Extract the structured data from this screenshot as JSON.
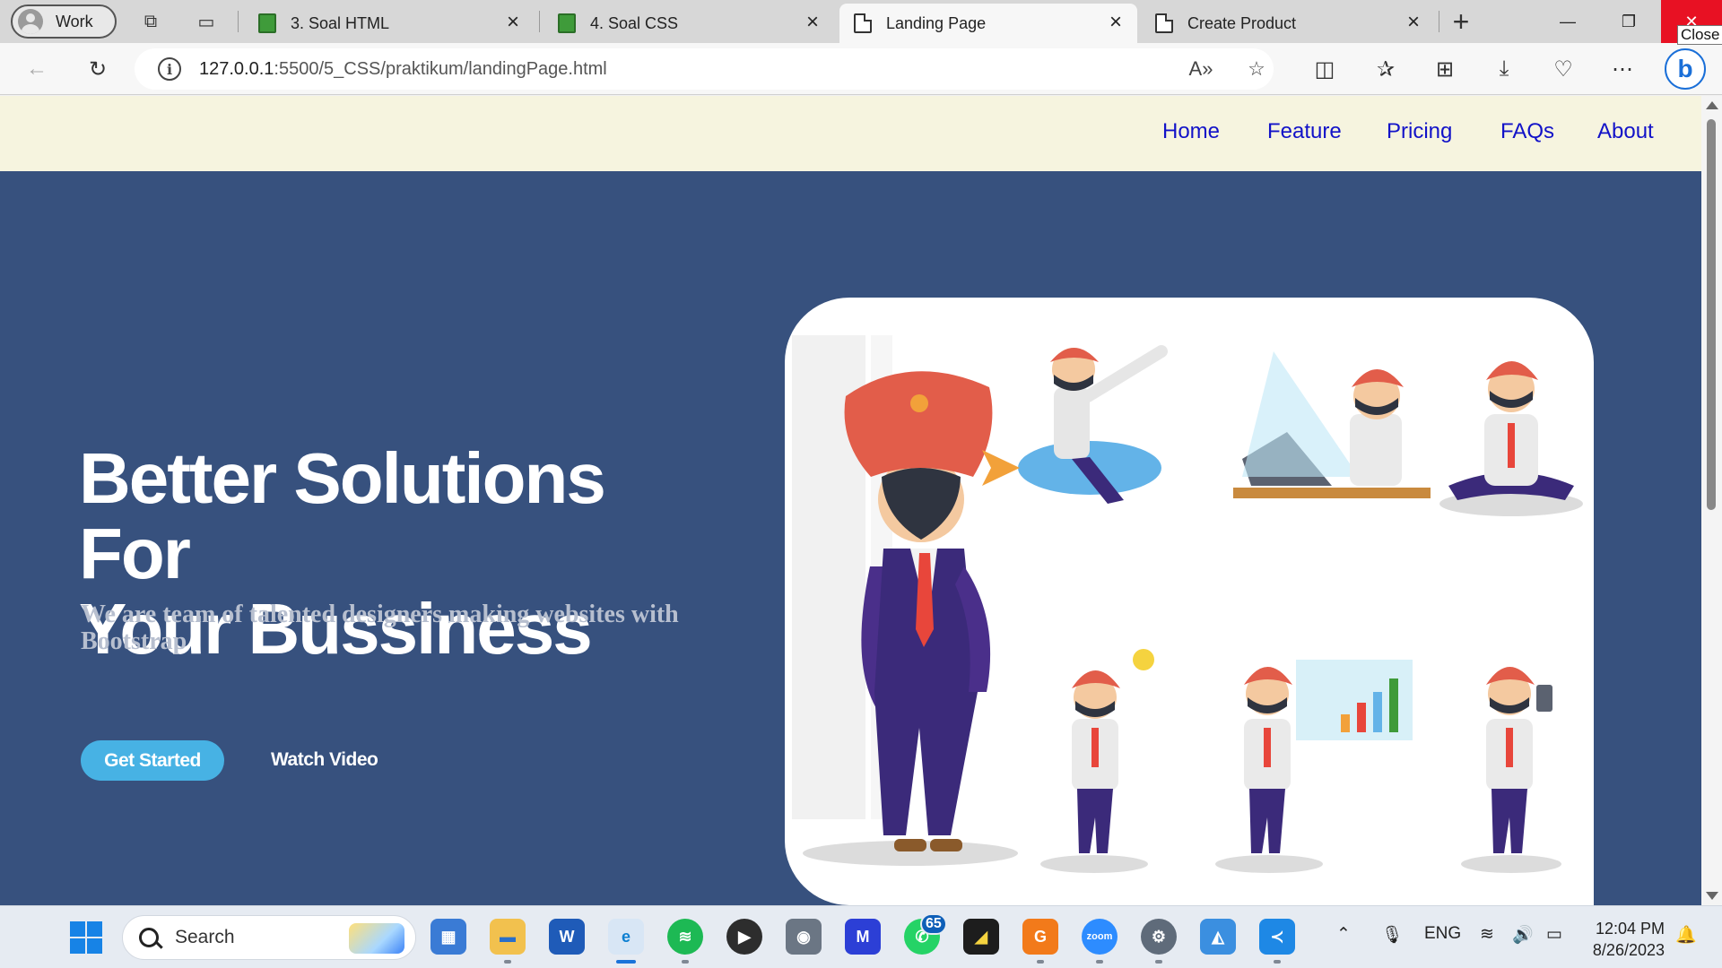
{
  "browser": {
    "profile_label": "Work",
    "tabs": [
      {
        "title": "3. Soal HTML",
        "favicon": "green-book-icon",
        "active": false
      },
      {
        "title": "4. Soal CSS",
        "favicon": "green-book-icon",
        "active": false
      },
      {
        "title": "Landing Page",
        "favicon": "document-icon",
        "active": true
      },
      {
        "title": "Create Product",
        "favicon": "document-icon",
        "active": false
      }
    ],
    "close_tooltip": "Close",
    "url_host": "127.0.0.1",
    "url_path": ":5500/5_CSS/praktikum/landingPage.html"
  },
  "site": {
    "nav": [
      "Home",
      "Feature",
      "Pricing",
      "FAQs",
      "About"
    ],
    "hero_title_line1": "Better Solutions For",
    "hero_title_line2": "Your Bussiness",
    "hero_subtitle": "We are team of talented designers making websites with Bootstrap",
    "cta_primary": "Get Started",
    "cta_secondary": "Watch Video",
    "colors": {
      "hero_bg": "#37517e",
      "nav_bg": "#f6f4df",
      "nav_link": "#1212c8",
      "button": "#47b2e4"
    },
    "hero_image": "turban-businessman-illustration-set"
  },
  "taskbar": {
    "search_placeholder": "Search",
    "whatsapp_badge": "65",
    "language": "ENG",
    "time": "12:04 PM",
    "date": "8/26/2023"
  }
}
